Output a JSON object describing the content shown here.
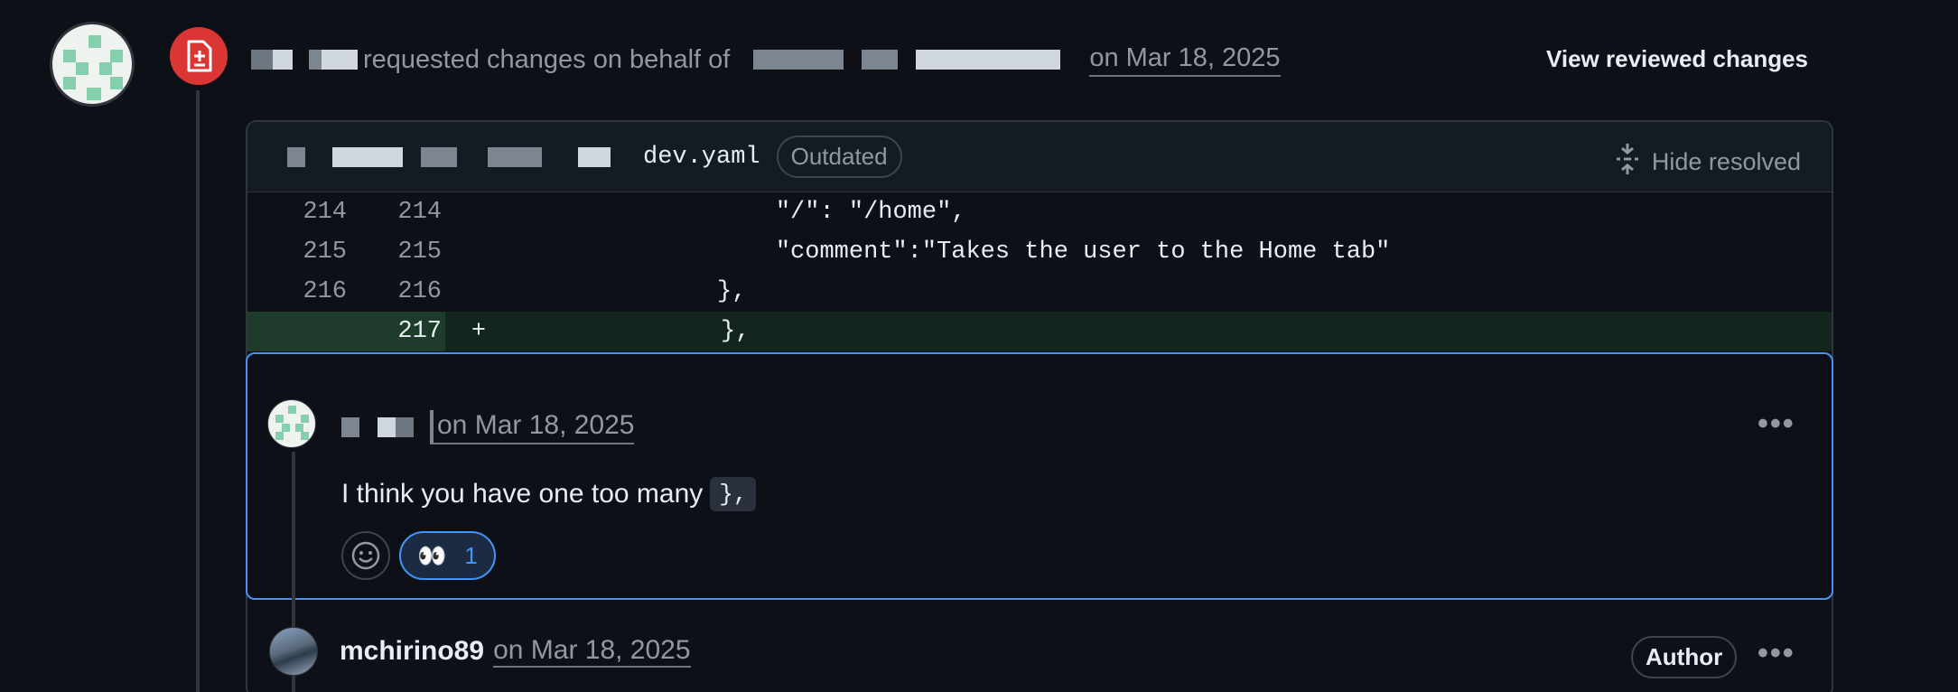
{
  "review": {
    "action_text": "requested changes on behalf of",
    "date": "on Mar 18, 2025",
    "view_button": "View reviewed changes"
  },
  "file": {
    "name": "dev.yaml",
    "status_badge": "Outdated",
    "hide_resolved": "Hide resolved"
  },
  "diff_lines": [
    {
      "old": "214",
      "new": "214",
      "sign": "",
      "text": "                   \"/\": \"/home\","
    },
    {
      "old": "215",
      "new": "215",
      "sign": "",
      "text": "                   \"comment\":\"Takes the user to the Home tab\""
    },
    {
      "old": "216",
      "new": "216",
      "sign": "",
      "text": "               },"
    },
    {
      "old": "",
      "new": "217",
      "sign": "+",
      "text": "               },"
    }
  ],
  "comment1": {
    "date": "on Mar 18, 2025",
    "text": "I think you have one too many",
    "code": "},",
    "reaction_emoji": "👀",
    "reaction_count": "1"
  },
  "comment2": {
    "author": "mchirino89",
    "date": "on Mar 18, 2025",
    "badge": "Author"
  },
  "icons": [
    "file-diff-icon",
    "fold-icon",
    "smiley-icon",
    "kebab-icon"
  ],
  "colors": {
    "accent": "#4493f8",
    "danger": "#da3633",
    "added_bg": "#12261e"
  }
}
